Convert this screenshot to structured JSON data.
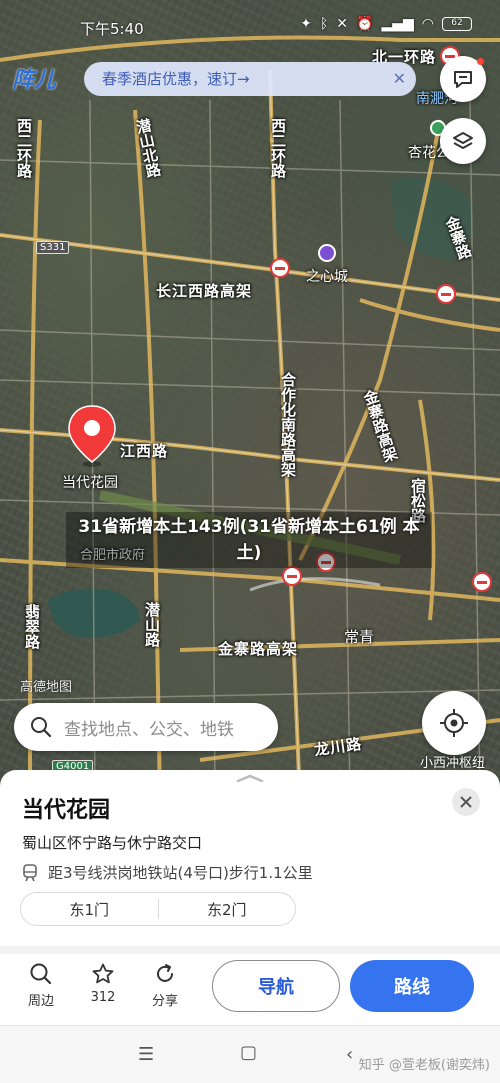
{
  "status_bar": {
    "time": "下午5:40",
    "battery": "62"
  },
  "promo": {
    "text": "春季酒店优惠，速订→",
    "logo_text": "阵儿"
  },
  "map": {
    "road_labels": {
      "xierhuan_w": "西二环路",
      "xierhuan_c": "西二环路",
      "beiyihuan": "北一环路",
      "qianshan_n": "潜山北路",
      "changjiang": "长江西路高架",
      "zhixin": "之心城",
      "jinzhai_ne": "金寨路",
      "jinzhai_gaojia_v": "金寨路高架",
      "hezuohua": "合作化南路高架",
      "jiangxi": "江西路",
      "susong": "宿松路",
      "feicui": "翡翠路",
      "qianshan": "潜山路",
      "jinzhai_gaojia_h": "金寨路高架",
      "changqing": "常青",
      "longchuan": "龙川路",
      "nanfei": "南淝河",
      "xinghua": "杏花公"
    },
    "poi_labels": {
      "dangdai": "当代花园",
      "government": "合肥市政府",
      "xiaoxi": "小西冲枢纽"
    },
    "shields": {
      "s331": "S331",
      "g4001": "G4001"
    },
    "amap_watermark": "高德地图"
  },
  "news_overlay": "31省新增本土143例(31省新增本土61例 本土)",
  "search": {
    "placeholder": "查找地点、公交、地铁"
  },
  "place": {
    "name": "当代花园",
    "address": "蜀山区怀宁路与休宁路交口",
    "metro": "距3号线洪岗地铁站(4号口)步行1.1公里",
    "gates": [
      "东1门",
      "东2门"
    ]
  },
  "actions": {
    "nearby": "周边",
    "favorite_count": "312",
    "share": "分享",
    "navigate": "导航",
    "route": "路线"
  },
  "system_nav": {
    "watermark": "知乎 @萱老板(谢奕炜)"
  },
  "colors": {
    "primary_blue": "#3574ee",
    "pin_red": "#f23a3a",
    "nav_text": "#2b5ed6"
  }
}
